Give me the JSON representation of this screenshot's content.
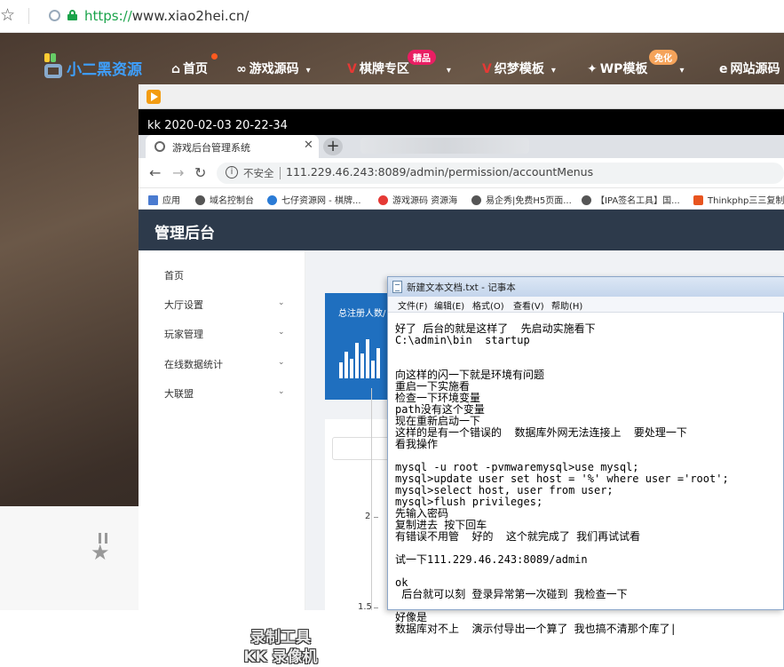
{
  "outer_browser": {
    "url_scheme": "https://",
    "url_host": "www.xiao2hei.cn/"
  },
  "site": {
    "logo_text": "小二黑资源",
    "nav": [
      {
        "label": "首页",
        "icon": "home-icon"
      },
      {
        "label": "游戏源码",
        "icon": "infinity-icon"
      },
      {
        "label": "棋牌专区",
        "icon": "v-icon"
      },
      {
        "label": "织梦模板",
        "icon": "v-icon"
      },
      {
        "label": "WP模板",
        "icon": "paw-icon"
      },
      {
        "label": "网站源码",
        "icon": "ie-icon"
      }
    ],
    "badge_hot": "精品",
    "badge_free": "免化"
  },
  "recording": {
    "title": "kk 2020-02-03 20-22-34",
    "watermark_line1": "录制工具",
    "watermark_line2": "KK 录像机"
  },
  "inner_browser": {
    "tab_title": "游戏后台管理系统",
    "not_secure": "不安全",
    "url": "111.229.46.243:8089/admin/permission/accountMenus",
    "bookmarks": [
      "应用",
      "域名控制台",
      "七仔资源网 - 棋牌...",
      "游戏源码 资源海",
      "易企秀|免费H5页面...",
      "【IPA签名工具】国...",
      "Thinkphp三三复制"
    ]
  },
  "admin": {
    "title": "管理后台",
    "menu": [
      {
        "label": "首页",
        "has_children": false
      },
      {
        "label": "大厅设置",
        "has_children": true
      },
      {
        "label": "玩家管理",
        "has_children": true
      },
      {
        "label": "在线数据统计",
        "has_children": true
      },
      {
        "label": "大联盟",
        "has_children": true
      }
    ],
    "stat_label": "总注册人数/",
    "axis_labels": [
      "2",
      "1.5"
    ]
  },
  "notepad": {
    "title": "新建文本文档.txt - 记事本",
    "menu": [
      "文件(F)",
      "编辑(E)",
      "格式(O)",
      "查看(V)",
      "帮助(H)"
    ],
    "lines": [
      "好了 后台的就是这样了  先启动实施看下",
      "C:\\admin\\bin  startup",
      "",
      "",
      "向这样的闪一下就是环境有问题",
      "重启一下实施看",
      "检查一下环境变量",
      "path没有这个变量",
      "现在重新启动一下",
      "这样的是有一个错误的  数据库外网无法连接上  要处理一下",
      "看我操作",
      "",
      "mysql -u root -pvmwaremysql>use mysql;",
      "mysql>update user set host = '%' where user ='root';",
      "mysql>select host, user from user;",
      "mysql>flush privileges;",
      "先输入密码",
      "复制进去 按下回车",
      "有错误不用管  好的  这个就完成了 我们再试试看",
      "",
      "试一下111.229.46.243:8089/admin",
      "",
      "ok",
      " 后台就可以刻 登录异常第一次碰到 我检查一下",
      "",
      "好像是",
      "数据库对不上  演示付导出一个算了 我也搞不清那个库了|"
    ]
  },
  "colors": {
    "accent_blue": "#3ea0ff",
    "admin_header": "#2d3a4b",
    "stat_card": "#1f6fbf",
    "secure_green": "#1aa34a"
  }
}
